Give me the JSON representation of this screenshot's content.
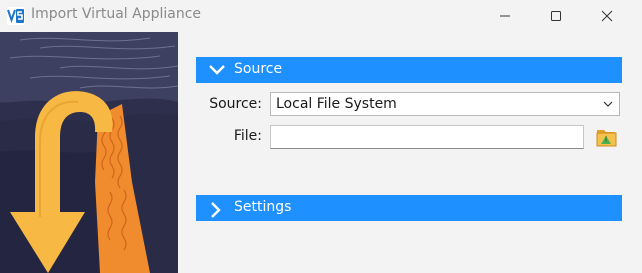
{
  "window": {
    "title": "Import Virtual Appliance",
    "app_icon": "virtualbox-icon",
    "controls": [
      "minimize-icon",
      "maximize-icon",
      "close-icon"
    ]
  },
  "sections": {
    "source": {
      "label": "Source",
      "expanded": true
    },
    "settings": {
      "label": "Settings",
      "expanded": false
    }
  },
  "form": {
    "source_label": "Source:",
    "source_value": "Local File System",
    "file_label": "File:",
    "file_value": "",
    "browse_icon": "folder-open-icon"
  },
  "colors": {
    "accent": "#1e90ff",
    "banner_dark": "#2e2f4c",
    "banner_orange": "#f5b747"
  }
}
